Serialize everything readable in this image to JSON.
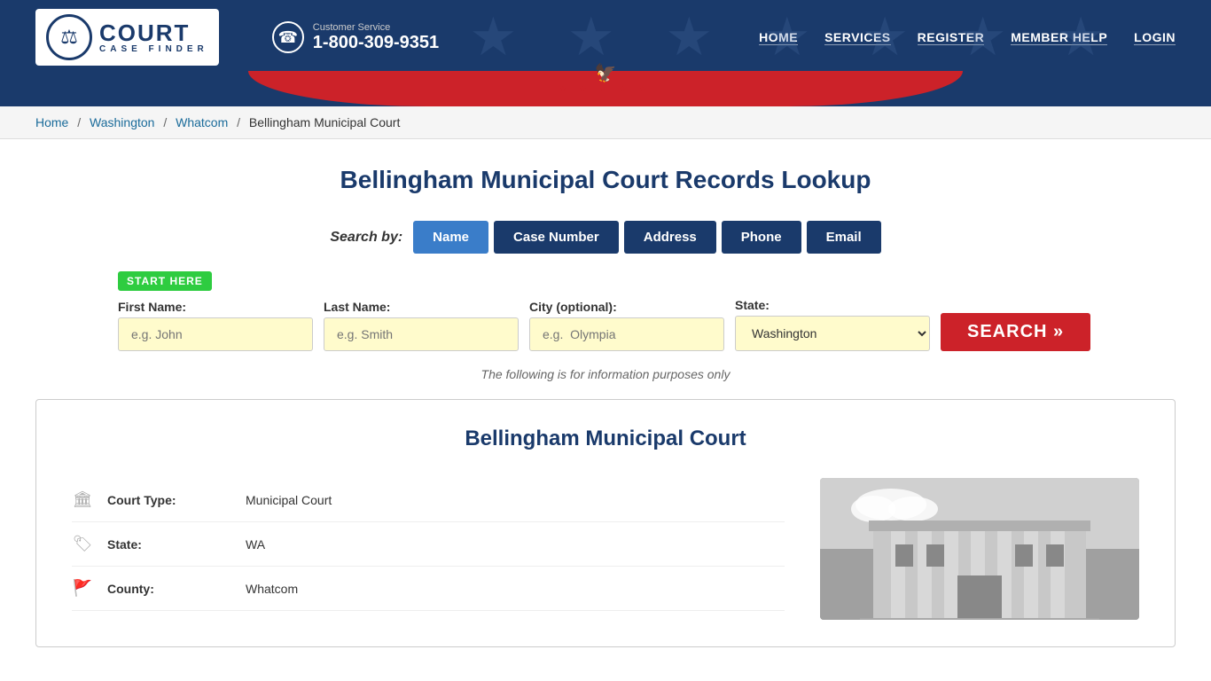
{
  "header": {
    "logo_title": "COURT",
    "logo_subtitle": "CASE FINDER",
    "logo_icon": "⚖",
    "customer_service_label": "Customer Service",
    "customer_service_phone": "1-800-309-9351",
    "nav": [
      {
        "label": "HOME",
        "href": "#"
      },
      {
        "label": "SERVICES",
        "href": "#"
      },
      {
        "label": "REGISTER",
        "href": "#"
      },
      {
        "label": "MEMBER HELP",
        "href": "#"
      },
      {
        "label": "LOGIN",
        "href": "#"
      }
    ]
  },
  "breadcrumb": {
    "home": "Home",
    "state": "Washington",
    "county": "Whatcom",
    "court": "Bellingham Municipal Court"
  },
  "page": {
    "title": "Bellingham Municipal Court Records Lookup",
    "search_by_label": "Search by:"
  },
  "search_tabs": [
    {
      "label": "Name",
      "active": true
    },
    {
      "label": "Case Number",
      "active": false
    },
    {
      "label": "Address",
      "active": false
    },
    {
      "label": "Phone",
      "active": false
    },
    {
      "label": "Email",
      "active": false
    }
  ],
  "form": {
    "start_here": "START HERE",
    "first_name_label": "First Name:",
    "first_name_placeholder": "e.g. John",
    "last_name_label": "Last Name:",
    "last_name_placeholder": "e.g. Smith",
    "city_label": "City (optional):",
    "city_placeholder": "e.g.  Olympia",
    "state_label": "State:",
    "state_value": "Washington",
    "search_button": "SEARCH »",
    "info_note": "The following is for information purposes only"
  },
  "court_info": {
    "title": "Bellingham Municipal Court",
    "court_type_label": "Court Type:",
    "court_type_value": "Municipal Court",
    "state_label": "State:",
    "state_value": "WA",
    "county_label": "County:",
    "county_value": "Whatcom"
  }
}
